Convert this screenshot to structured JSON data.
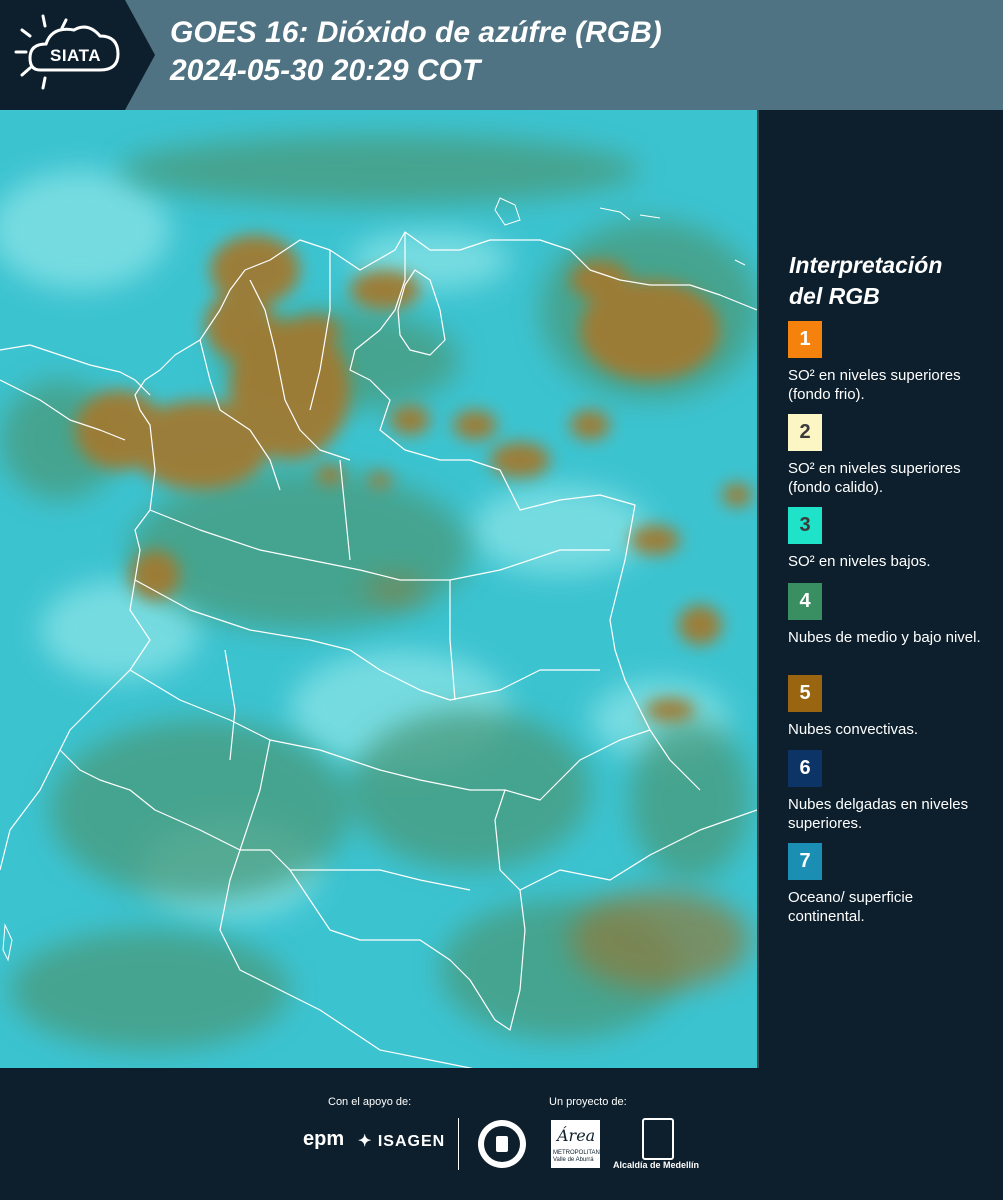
{
  "header": {
    "logo_text": "SIATA",
    "title_line1": "GOES 16: Dióxido de azúfre (RGB)",
    "title_line2": " 2024-05-30 20:29 COT",
    "background_color": "#4f7383"
  },
  "legend": {
    "title_line1": "Interpretación",
    "title_line2": "del RGB",
    "items": [
      {
        "number": "1",
        "color": "#f5820d",
        "text_color": "#ffffff",
        "label": "SO² en niveles superiores (fondo frio)."
      },
      {
        "number": "2",
        "color": "#fcf5c4",
        "text_color": "#3a3a3a",
        "label": "SO² en niveles superiores (fondo calido)."
      },
      {
        "number": "3",
        "color": "#1ee3c8",
        "text_color": "#3a3a3a",
        "label": "SO² en niveles bajos."
      },
      {
        "number": "4",
        "color": "#3a8f62",
        "text_color": "#ffffff",
        "label": "Nubes de medio y bajo nivel."
      },
      {
        "number": "5",
        "color": "#9a6510",
        "text_color": "#ffffff",
        "label": "Nubes convectivas."
      },
      {
        "number": "6",
        "color": "#0d3466",
        "text_color": "#ffffff",
        "label": "Nubes delgadas en niveles superiores."
      },
      {
        "number": "7",
        "color": "#1a8fb3",
        "text_color": "#ffffff",
        "label": "Oceano/ superficie continental."
      }
    ]
  },
  "footer": {
    "support_label": "Con el apoyo de:",
    "project_label": "Un proyecto de:",
    "sponsor_epm": "epm",
    "sponsor_isagen": "ISAGEN",
    "partner_area_word": "Área",
    "partner_area_sub": "METROPOLITANA Valle de Aburrá",
    "partner_alcaldia": "Alcaldía de Medellín"
  },
  "map": {
    "colors": {
      "base": "#3cc3d0",
      "low_cloud": "#4a9a7a",
      "convective": "#a07a30",
      "bright": "#8fe6e8",
      "borders": "#ffffff"
    }
  }
}
